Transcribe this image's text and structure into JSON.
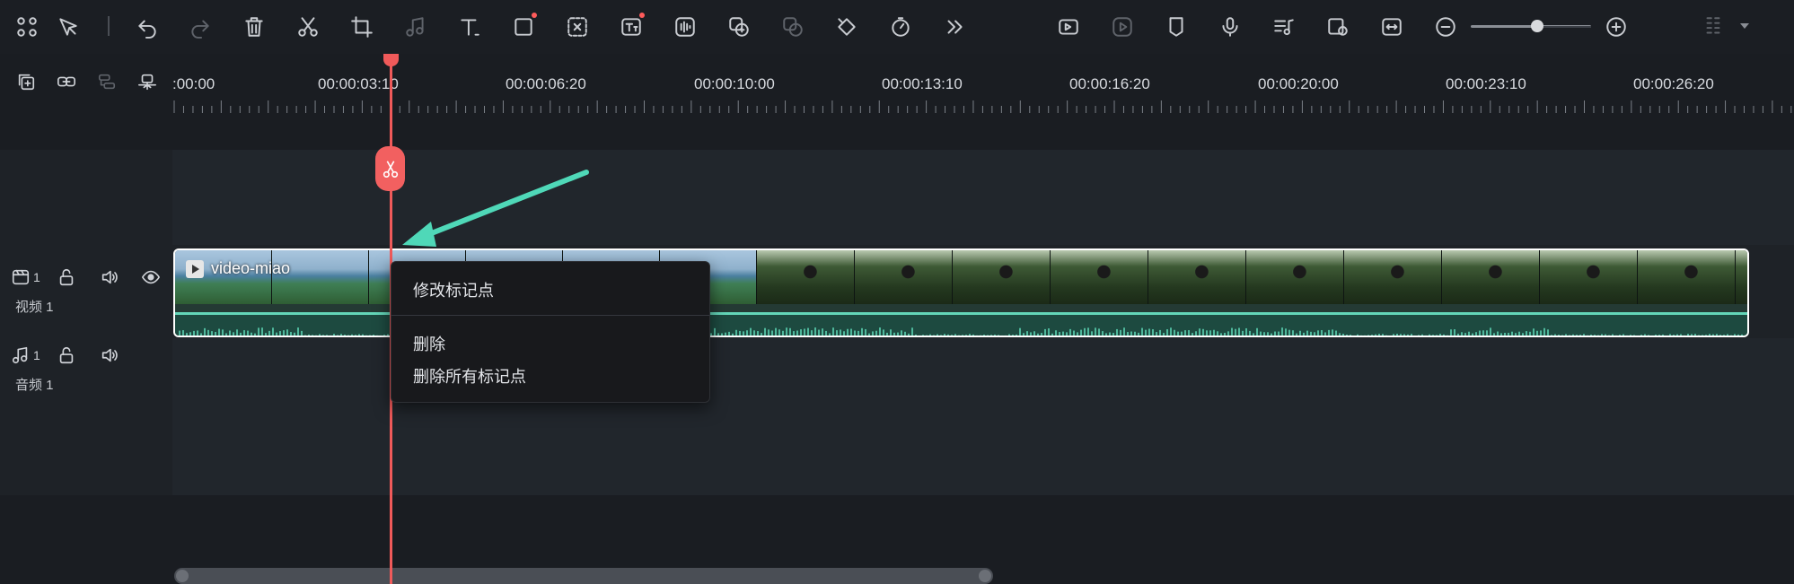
{
  "toolbar": {
    "left_tools": [
      "grid-icon",
      "select-tool-icon",
      "undo-icon",
      "redo-icon",
      "delete-icon",
      "cut-icon",
      "crop-icon",
      "audio-stretch-icon",
      "text-icon",
      "shape-icon",
      "ai-mask-icon",
      "ai-text-icon",
      "audio-waveform-icon",
      "speech-to-text-icon",
      "voice-changer-icon",
      "keyframe-icon",
      "speed-icon",
      "more-icon"
    ],
    "right_tools": [
      "auto-reframe-icon",
      "render-preview-icon",
      "marker-icon",
      "microphone-icon",
      "audio-mixer-icon",
      "snapshot-icon",
      "fit-timeline-icon",
      "zoom-out-icon",
      "zoom-in-icon",
      "layout-icon"
    ],
    "zoom_level": 0.55
  },
  "timeline_tools": [
    "add-track-icon",
    "link-icon",
    "group-icon",
    "snap-icon"
  ],
  "ruler": {
    "labels": [
      ":00:00",
      "00:00:03:10",
      "00:00:06:20",
      "00:00:10:00",
      "00:00:13:10",
      "00:00:16:20",
      "00:00:20:00",
      "00:00:23:10",
      "00:00:26:20"
    ]
  },
  "tracks": {
    "video": {
      "num": "1",
      "name": "视频 1"
    },
    "audio": {
      "num": "1",
      "name": "音频 1"
    }
  },
  "clip": {
    "title": "video-miao"
  },
  "context_menu": {
    "edit_marker": "修改标记点",
    "delete": "删除",
    "delete_all_markers": "删除所有标记点"
  },
  "colors": {
    "playhead": "#f05a5a",
    "audio_accent": "#63d6b8",
    "arrow": "#4fd8b8"
  }
}
